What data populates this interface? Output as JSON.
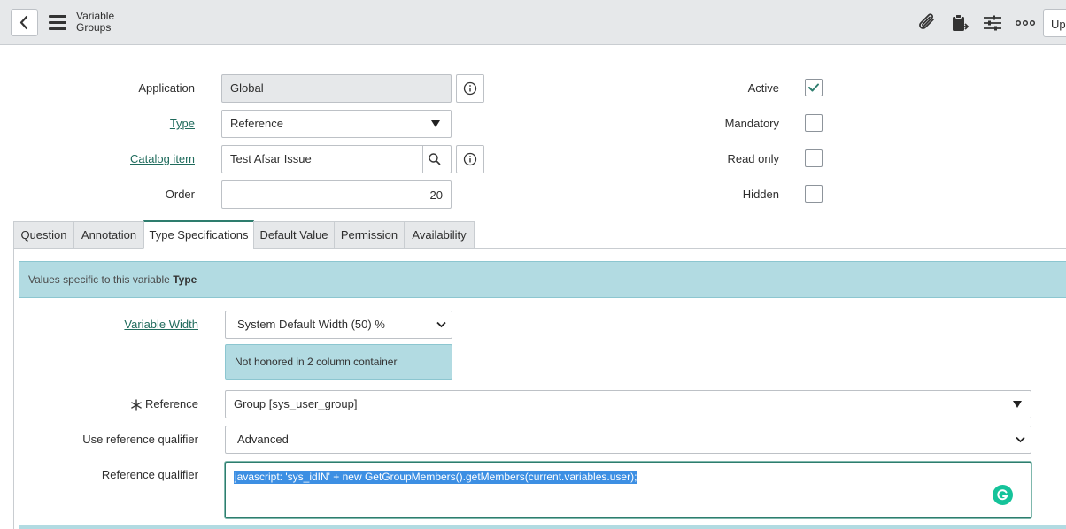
{
  "header": {
    "title_line1": "Variable",
    "title_line2": "Groups",
    "update_label": "Up"
  },
  "form": {
    "application": {
      "label": "Application",
      "value": "Global"
    },
    "type": {
      "label": "Type",
      "value": "Reference"
    },
    "catalog_item": {
      "label": "Catalog item",
      "value": "Test Afsar Issue"
    },
    "order": {
      "label": "Order",
      "value": "20"
    },
    "active": {
      "label": "Active",
      "checked": true
    },
    "mandatory": {
      "label": "Mandatory",
      "checked": false
    },
    "read_only": {
      "label": "Read only",
      "checked": false
    },
    "hidden": {
      "label": "Hidden",
      "checked": false
    }
  },
  "tabs": [
    "Question",
    "Annotation",
    "Type Specifications",
    "Default Value",
    "Permission",
    "Availability"
  ],
  "active_tab": "Type Specifications",
  "type_specs": {
    "banner_prefix": "Values specific to this variable",
    "banner_bold": "Type",
    "variable_width": {
      "label": "Variable Width",
      "value": "System Default Width (50) %"
    },
    "note": "Not honored in 2 column container",
    "reference": {
      "label": "Reference",
      "value": "Group [sys_user_group]"
    },
    "use_ref_qualifier": {
      "label": "Use reference qualifier",
      "value": "Advanced"
    },
    "ref_qualifier": {
      "label": "Reference qualifier",
      "value": "javascript: 'sys_idIN' + new GetGroupMembers().getMembers(current.variables.user);"
    }
  },
  "colors": {
    "accent": "#2e7d6e",
    "link": "#1f6b5c",
    "info_banner": "#b2dbe2",
    "selection": "#3d8fe3",
    "grammarly": "#15c39a"
  }
}
